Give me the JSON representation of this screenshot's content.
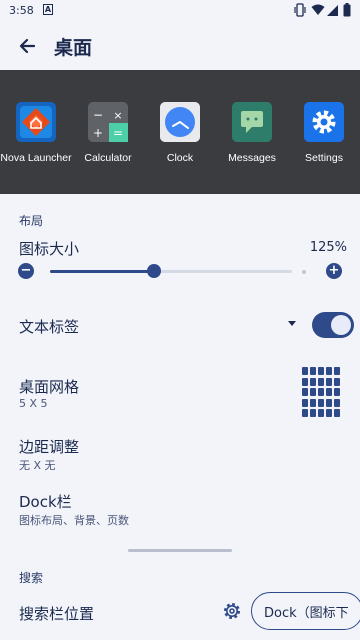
{
  "status_bar": {
    "time": "3:58",
    "notification_letter": "A"
  },
  "app_bar": {
    "title": "桌面"
  },
  "preview": {
    "apps": [
      {
        "label": "Nova Launcher",
        "icon": "nova-launcher-icon",
        "color": "#e64a19"
      },
      {
        "label": "Calculator",
        "icon": "calculator-icon",
        "color": "#5f6368"
      },
      {
        "label": "Clock",
        "icon": "clock-icon",
        "color": "#4285f4"
      },
      {
        "label": "Messages",
        "icon": "messages-icon",
        "color": "#2e7d6b"
      },
      {
        "label": "Settings",
        "icon": "settings-icon",
        "color": "#1a73e8"
      }
    ]
  },
  "layout_section": {
    "header": "布局",
    "icon_size": {
      "title": "图标大小",
      "value": "125%",
      "fraction": 0.43,
      "minus": "−",
      "plus": "+"
    },
    "text_labels": {
      "title": "文本标签",
      "enabled": true
    },
    "desktop_grid": {
      "title": "桌面网格",
      "subtitle": "5 X 5"
    },
    "margin": {
      "title": "边距调整",
      "subtitle": "无 X 无"
    },
    "dock": {
      "title": "Dock栏",
      "subtitle": "图标布局、背景、页数"
    }
  },
  "search_section": {
    "header": "搜索",
    "search_bar_position": {
      "title": "搜索栏位置",
      "button_label": "Dock（图标下"
    }
  },
  "colors": {
    "accent": "#2e4a8a",
    "background": "#f2f4fa",
    "preview_bg": "#3a3c40",
    "text": "#1b2a4e"
  }
}
